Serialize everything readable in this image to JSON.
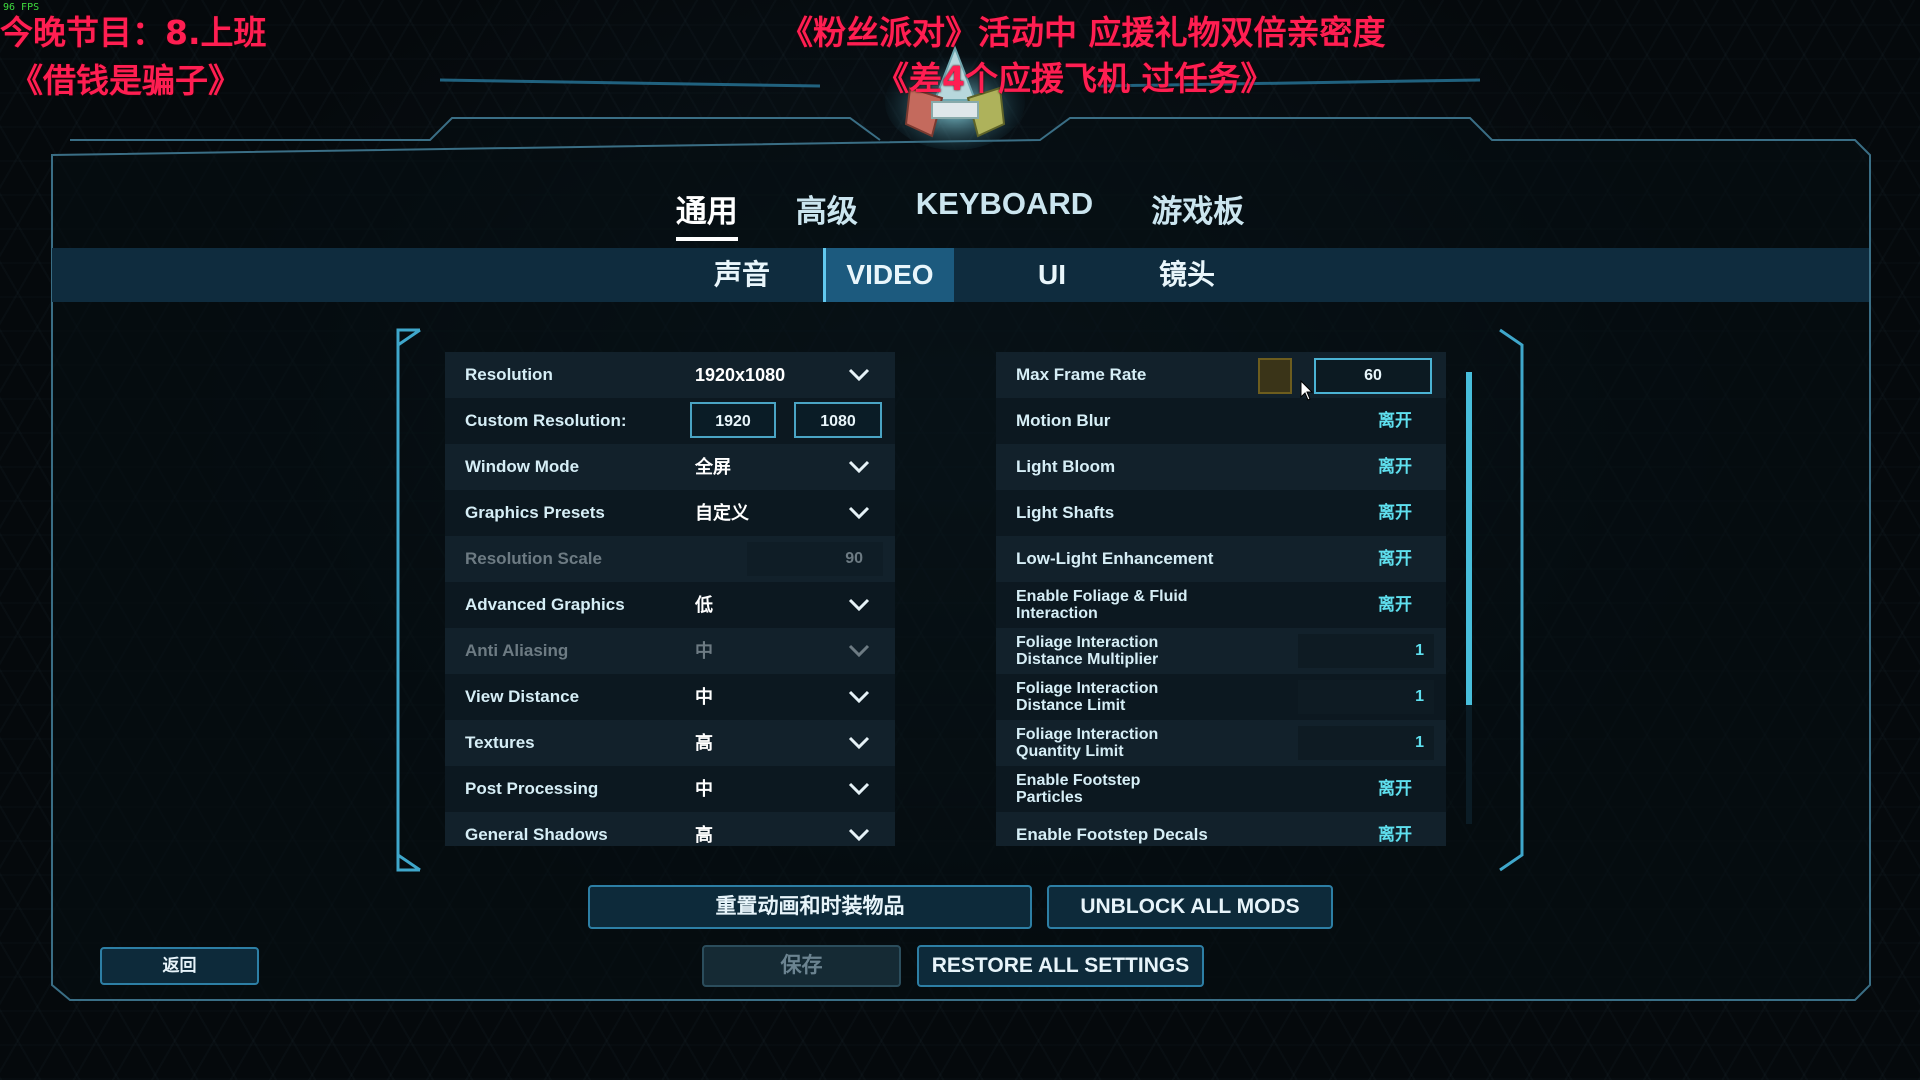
{
  "overlay": {
    "fps": "96 FPS",
    "left_line1": "今晚节目：8.上班",
    "left_line2": "《借钱是骗子》",
    "center_line1": "《粉丝派对》活动中 应援礼物双倍亲密度",
    "center_line2": "《差4个应援飞机 过任务》"
  },
  "top_tabs": [
    {
      "label": "通用",
      "active": true
    },
    {
      "label": "高级",
      "active": false
    },
    {
      "label": "KEYBOARD",
      "active": false
    },
    {
      "label": "游戏板",
      "active": false
    }
  ],
  "sub_tabs": [
    {
      "label": "声音",
      "active": false
    },
    {
      "label": "VIDEO",
      "active": true
    },
    {
      "label": "UI",
      "active": false
    },
    {
      "label": "镜头",
      "active": false
    }
  ],
  "left_settings": {
    "resolution": {
      "label": "Resolution",
      "value": "1920x1080"
    },
    "custom_resolution": {
      "label": "Custom Resolution:",
      "width": "1920",
      "height": "1080"
    },
    "window_mode": {
      "label": "Window Mode",
      "value": "全屏"
    },
    "graphics_presets": {
      "label": "Graphics Presets",
      "value": "自定义"
    },
    "resolution_scale": {
      "label": "Resolution Scale",
      "value": "90"
    },
    "advanced_graphics": {
      "label": "Advanced Graphics",
      "value": "低"
    },
    "anti_aliasing": {
      "label": "Anti Aliasing",
      "value": "中"
    },
    "view_distance": {
      "label": "View Distance",
      "value": "中"
    },
    "textures": {
      "label": "Textures",
      "value": "高"
    },
    "post_processing": {
      "label": "Post Processing",
      "value": "中"
    },
    "general_shadows": {
      "label": "General Shadows",
      "value": "高"
    }
  },
  "right_settings": {
    "max_frame_rate": {
      "label": "Max Frame Rate",
      "value": "60",
      "swatch_color": "#3a3418"
    },
    "motion_blur": {
      "label": "Motion Blur",
      "value": "离开"
    },
    "light_bloom": {
      "label": "Light Bloom",
      "value": "离开"
    },
    "light_shafts": {
      "label": "Light Shafts",
      "value": "离开"
    },
    "low_light": {
      "label": "Low-Light Enhancement",
      "value": "离开"
    },
    "foliage_fluid": {
      "label_line1": "Enable Foliage & Fluid",
      "label_line2": "Interaction",
      "value": "离开"
    },
    "foliage_dist_mult": {
      "label_line1": "Foliage Interaction",
      "label_line2": "Distance Multiplier",
      "value": "1"
    },
    "foliage_dist_limit": {
      "label_line1": "Foliage Interaction",
      "label_line2": "Distance Limit",
      "value": "1"
    },
    "foliage_qty_limit": {
      "label_line1": "Foliage Interaction",
      "label_line2": "Quantity Limit",
      "value": "1"
    },
    "footstep_particles": {
      "label_line1": "Enable Footstep",
      "label_line2": "Particles",
      "value": "离开"
    },
    "footstep_decals": {
      "label": "Enable Footstep Decals",
      "value": "离开"
    }
  },
  "scroll_position": 0.0,
  "buttons": {
    "reset_anim": "重置动画和时装物品",
    "unblock_mods": "UNBLOCK ALL MODS",
    "back": "返回",
    "save": "保存",
    "restore": "RESTORE ALL SETTINGS"
  },
  "colors": {
    "accent": "#48bedb",
    "toggle_text": "#5fe0ef",
    "overlay_text": "#ff1e52"
  }
}
